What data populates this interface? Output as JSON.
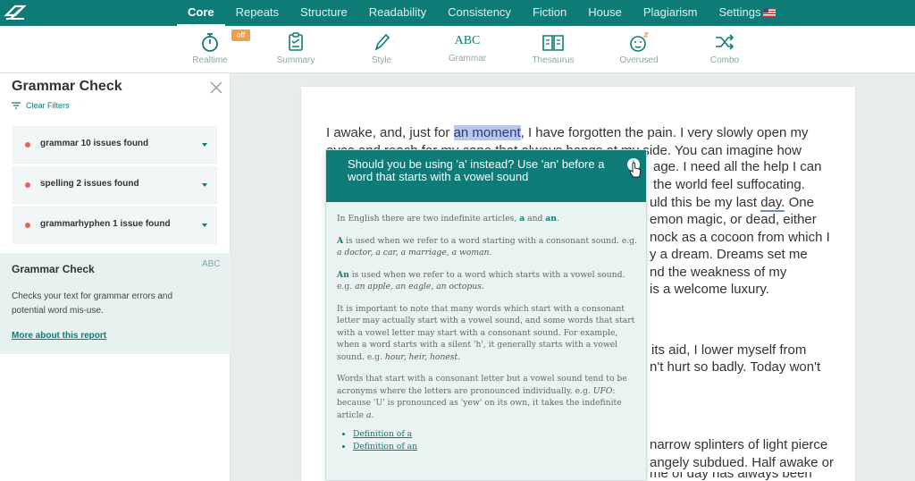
{
  "nav": {
    "tabs": [
      "Core",
      "Repeats",
      "Structure",
      "Readability",
      "Consistency",
      "Fiction",
      "House",
      "Plagiarism",
      "Settings"
    ],
    "active": "Core"
  },
  "toolbar": {
    "realtime": "Realtime",
    "realtime_badge": "off",
    "summary": "Summary",
    "style": "Style",
    "grammar": "Grammar",
    "grammar_icon_text": "ABC",
    "thesaurus": "Thesaurus",
    "overused": "Overused",
    "combo": "Combo"
  },
  "sidebar": {
    "title": "Grammar Check",
    "clear_filters": "Clear Filters",
    "issues": [
      "grammar 10 issues found",
      "spelling 2 issues found",
      "grammarhyphen 1 issue found"
    ],
    "report": {
      "title": "Grammar Check",
      "icon_text": "ABC",
      "description": "Checks your text for grammar errors and potential word mis-use.",
      "link": "More about this report"
    }
  },
  "doc": {
    "p1_before": "I awake, and, just for ",
    "p1_highlight": "an moment",
    "p1_after": ", I have forgotten the pain. I very slowly open my",
    "line2": "eyes and reach for my cane that always hangs at my side. You can imagine how",
    "right_lines": [
      "age. I need all the help I can",
      "the world feel suffocating.",
      "uld this be my last ",
      "emon magic, or dead, either",
      "nock as a cocoon from which I",
      "y a dream. Dreams set me",
      "nd the weakness of my",
      "is a welcome luxury.",
      "its aid, I lower myself from",
      "n't hurt so badly. Today won't",
      "narrow splinters of light pierce",
      "angely subdued. Half awake or",
      "me of day has always been"
    ],
    "underlined_word": "day.",
    "after_underlined": " One"
  },
  "popover": {
    "title": "Should you be using 'a' instead? Use 'an' before a word that starts with a vowel sound",
    "info": "i",
    "intro_text": "In English there are two indefinite articles, ",
    "intro_a": "a",
    "intro_and": " and ",
    "intro_an": "an",
    "intro_end": ".",
    "a_word": "A",
    "a_text": " is used when we refer to a word starting with a consonant sound. e.g. ",
    "a_examples": "a doctor, a car, a marriage, a woman.",
    "an_word": "An",
    "an_text": " is used when we refer to a word which starts with a vowel sound. e.g. ",
    "an_examples": "an apple, an eagle, an octopus.",
    "para3_text": "It is important to note that many words which start with a consonant letter may actually start with a vowel sound, and some words that start with a vowel letter may start with a consonant sound. For example, when a word starts with a silent 'h', it generally starts with a vowel sound. e.g. ",
    "para3_examples": "hour, heir, honest.",
    "para4_text": "Words that start with a consonant letter but a vowel sound tend to be acronyms where the letters are pronounced individually. e.g. ",
    "para4_example": "UFO",
    "para4_rest": ": because 'U' is pronounced as 'yew' on its own, it takes the indefinite article ",
    "para4_article": "a",
    "para4_end": ".",
    "links": [
      "Definition of a",
      "Definition of an"
    ]
  },
  "colors": {
    "brand": "#0e7b77",
    "highlight": "#b9c7ea",
    "issue_dot": "#e8625a",
    "badge": "#f0a04b"
  }
}
